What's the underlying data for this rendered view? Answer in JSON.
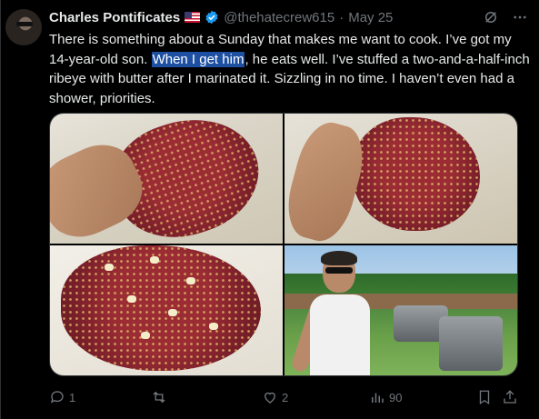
{
  "author": {
    "name": "Charles Pontificates",
    "handle": "@thehatecrew615",
    "separator": "·",
    "date": "May 25"
  },
  "tweet": {
    "text_before": "There is something about a Sunday that makes me want to cook. I’ve got my 14-year-old son. ",
    "text_highlight": "When I get him",
    "text_after": ", he eats well. I’ve stuffed a two-and-a-half-inch ribeye with butter after I marinated it. Sizzling in no time. I haven’t even had a shower, priorities."
  },
  "actions": {
    "replies": "1",
    "reposts": "",
    "likes": "2",
    "views": "90"
  },
  "colors": {
    "highlight": "#1d4fa3",
    "verified": "#1d9bf0",
    "muted": "#71767b"
  },
  "icons": [
    "flag-us-icon",
    "verified-badge-icon",
    "grok-icon",
    "more-icon",
    "reply-icon",
    "repost-icon",
    "like-icon",
    "views-icon",
    "bookmark-icon",
    "share-icon"
  ]
}
